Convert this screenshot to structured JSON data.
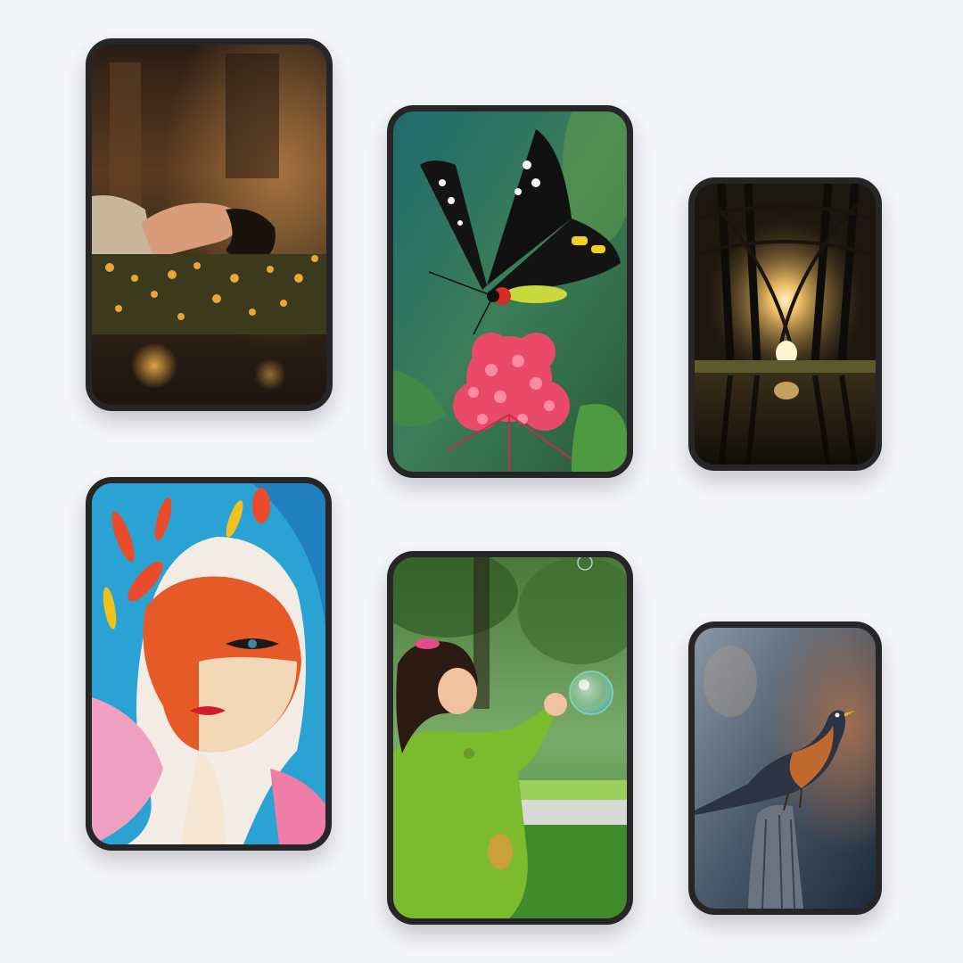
{
  "gallery": {
    "card_border_color": "#262626",
    "background_color": "#f4f5f9",
    "cards": [
      {
        "id": "c1",
        "subject": "woman-lying-among-flowers",
        "palette": [
          "#3a2a1c",
          "#b8783e",
          "#f0c070"
        ]
      },
      {
        "id": "c2",
        "subject": "butterfly-on-red-flower",
        "palette": [
          "#2c6d6a",
          "#e94466",
          "#111111"
        ]
      },
      {
        "id": "c3",
        "subject": "forest-tunnel-reflection",
        "palette": [
          "#1b1710",
          "#7a6a45",
          "#ffe3a0"
        ]
      },
      {
        "id": "c4",
        "subject": "watercolor-woman-portrait",
        "palette": [
          "#2aa6d6",
          "#e95a2a",
          "#f2a0c0"
        ]
      },
      {
        "id": "c5",
        "subject": "girl-catching-bubble",
        "palette": [
          "#3c7a32",
          "#8ec63f",
          "#d8e8d0"
        ]
      },
      {
        "id": "c6",
        "subject": "robin-on-stump",
        "palette": [
          "#3a4c5c",
          "#b8683c",
          "#7d8a96"
        ]
      }
    ]
  }
}
